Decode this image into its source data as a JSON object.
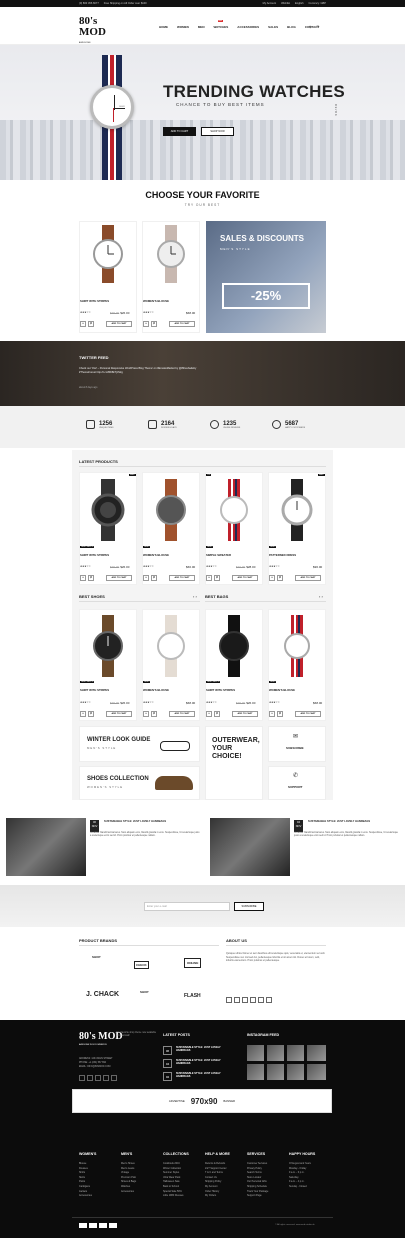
{
  "topbar": {
    "phone": "(0) 800 456 6677",
    "promo": "Free Shipping on All Order over $100",
    "links": [
      "My Account",
      "Wishlist",
      "English",
      "Currency: GBP"
    ]
  },
  "header": {
    "logo": "80's MOD",
    "logo_tag": "AWESOME WOOCOMMERCE",
    "nav": [
      "HOME",
      "WOMEN",
      "MEN",
      "WATCHES",
      "ACCESSORIES",
      "SALES",
      "BLOG",
      "CONTACT"
    ],
    "nav_badge": "HOT",
    "cart_count": "0"
  },
  "hero": {
    "title": "TRENDING WATCHES",
    "subtitle": "CHANCE TO BUY BEST ITEMS",
    "btn_cart": "ADD TO CART",
    "btn_shop": "SHOP NOW",
    "side": "03/04",
    "watch_label": "DEMO"
  },
  "favorite": {
    "title": "CHOOSE YOUR FAVORITE",
    "subtitle": "TRY OUR BEST",
    "products": [
      {
        "name": "SHIRT WITH STRIPES",
        "old": "$35.00",
        "price": "$26.00"
      },
      {
        "name": "WOMEN'S BLOUSE",
        "old": "",
        "price": "$68.00"
      }
    ],
    "add_to_cart": "ADD TO CART"
  },
  "promo": {
    "title": "SALES & DISCOUNTS",
    "subtitle": "MEN'S STYLE",
    "discount": "-25%"
  },
  "twitter": {
    "title": "TWITTER FEED",
    "text": "Check out 'Owl' – Personal Responsive WordPress Blog Theme' on #EnvatoMarket by @8theshadeby #ThemeForest http://t.co/8W8kTjzN2g",
    "time": "about 8 days ago"
  },
  "stats": [
    {
      "num": "1256",
      "label": "UNIQUE ITEMS"
    },
    {
      "num": "2164",
      "label": "WORKING DAYS"
    },
    {
      "num": "1235",
      "label": "ONLINE REVIEWS"
    },
    {
      "num": "5687",
      "label": "HAPPY CUSTOMERS"
    }
  ],
  "latest": {
    "title": "LATEST PRODUCTS",
    "products": [
      {
        "name": "SHIRT WITH STRIPES",
        "old": "$35.00",
        "price": "$26.00",
        "tag": "SALE",
        "cat": "DEMO WATCH"
      },
      {
        "name": "WOMEN'S BLOUSE",
        "old": "",
        "price": "$66.00",
        "tag": "",
        "cat": "DEMO"
      },
      {
        "name": "SIMPLE SWEATER",
        "old": "$30.00",
        "price": "$28.00",
        "tag": "-9%",
        "cat": "DEMO"
      },
      {
        "name": "PATTERNED DRESS",
        "old": "",
        "price": "$96.00",
        "tag": "SALE",
        "cat": "DEMO"
      }
    ]
  },
  "best_shoes": {
    "title": "BEST SHOES",
    "products": [
      {
        "name": "SHIRT WITH STRIPES",
        "old": "$35.00",
        "price": "$26.00",
        "cat": "DEMO WATCH"
      },
      {
        "name": "WOMEN'S BLOUSE",
        "old": "",
        "price": "$68.00",
        "cat": "DEMO"
      }
    ]
  },
  "best_bags": {
    "title": "BEST BAGS",
    "products": [
      {
        "name": "SHIRT WITH STRIPES",
        "old": "$35.00",
        "price": "$26.00",
        "cat": "DEMO WATCH"
      },
      {
        "name": "WOMEN'S BLOUSE",
        "old": "",
        "price": "$68.00",
        "cat": "DEMO"
      }
    ]
  },
  "banners": {
    "winter": "WINTER LOOK GUIDE",
    "winter_sub": "MEN'S STYLE",
    "shoes": "SHOES COLLECTION",
    "shoes_sub": "WOMEN'S STYLE",
    "outerwear": "OUTERWEAR, YOUR CHOICE!",
    "subscribe": "SUBSCRIBE",
    "support": "SUPPORT"
  },
  "blog": [
    {
      "day": "06",
      "month": "NOV",
      "title": "SUSTAINABLE STYLE: JUST LOVELY HANDBAGS",
      "text": "Curabitur blandit lacinia lacus. Nam aliquam eros, blandit gravida in eros. Suspendisse, Ut scelerisque justo a scelerisque enim sed id. Proin pulvinar et pellentesque nullam."
    },
    {
      "day": "04",
      "month": "NOV",
      "title": "SUSTAINABLE STYLE: JUST LOVELY HANDBAGS",
      "text": "Curabitur blandit lacinia lacus. Nam aliquam eros, blandit gravida in eros. Suspendisse, Ut scelerisque justo a scelerisque enim sed id. Proin pulvinar et pellentesque nullam."
    }
  ],
  "newsletter": {
    "placeholder": "Enter your e-mail",
    "button": "SUBSCRIBE"
  },
  "brands": {
    "title": "PRODUCT BRANDS",
    "items": [
      "SHOP",
      "CHECK",
      "ONLINE",
      "J. CHACK",
      "SHOP",
      "FLASH"
    ]
  },
  "about": {
    "title": "ABOUT US",
    "text": "Quisque ultrice Donec et sem faucibus elit scelerisque quis, venenatis et, elementum vel velit. Suspendisse nec nisl sed dui, pellentesque lobortis et sit amet nisl. Donec et lorem, velit, lobortis elementum. Proin pulvinar et pellentesque."
  },
  "footer": {
    "logo": "80's MOD",
    "logo_tag": "AWESOME WOOCOMMERCE",
    "tagline": "Your favorite shop theme now available for download!",
    "address": "ADDRESS: 1234 MAIN STREET",
    "phone": "PHONE: +1 (234) 567 890",
    "email": "EMAIL: INFO@80SMOD.COM",
    "latest_title": "LATEST POSTS",
    "posts": [
      {
        "day": "06",
        "title": "SUSTAINABLE STYLE: JUST LOVELY HANDBAGS"
      },
      {
        "day": "04",
        "title": "SUSTAINABLE STYLE: JUST LOVELY HANDBAGS"
      },
      {
        "day": "02",
        "title": "SUSTAINABLE STYLE: JUST LOVELY HANDBAGS"
      }
    ],
    "insta_title": "INSTAGRAM FEED",
    "ad": {
      "left": "ADVERTISE",
      "size": "970x90",
      "right": "BANNER"
    },
    "columns": [
      {
        "title": "WOMEN'S",
        "links": [
          "Blouse",
          "Dresses",
          "Shirts",
          "Skirts",
          "Pants",
          "Cardigans",
          "Jackets",
          "Accessories"
        ]
      },
      {
        "title": "MEN'S",
        "links": [
          "Men's Shoes",
          "Men's Jeans",
          "Vintage",
          "Premium Polo",
          "Shoes & Bags",
          "Watches",
          "Accessories"
        ]
      },
      {
        "title": "COLLECTIONS",
        "links": [
          "Cookbook 2016",
          "Winter Collection",
          "Summer Styles",
          "Ultra Wear Pack",
          "Halloween Sale",
          "Back to School",
          "Special Sale 50%",
          "Little 1980 Dresses"
        ]
      },
      {
        "title": "HELP & MORE",
        "links": [
          "Returns & Refunds",
          "24/7 Support Center",
          "T & C and Terms",
          "Contact Us",
          "Shipping Policy",
          "My Account",
          "Order History",
          "My Orders"
        ]
      },
      {
        "title": "SERVICES",
        "links": [
          "Customer Services",
          "Privacy Policy",
          "Search Terms",
          "Store Locator",
          "Our Personal Gifts",
          "Shipping Schedule",
          "Track Your Package",
          "Support Page"
        ]
      },
      {
        "title": "HAPPY HOURS",
        "links": [
          "Of August and Years",
          "Monday - Friday",
          "9 a.m. - 6 p.m.",
          "Saturday",
          "9 a.m. - 4 p.m.",
          "Sunday - Closed"
        ]
      }
    ],
    "copyright": "© All rights reserved. www.web-studio.uk"
  }
}
